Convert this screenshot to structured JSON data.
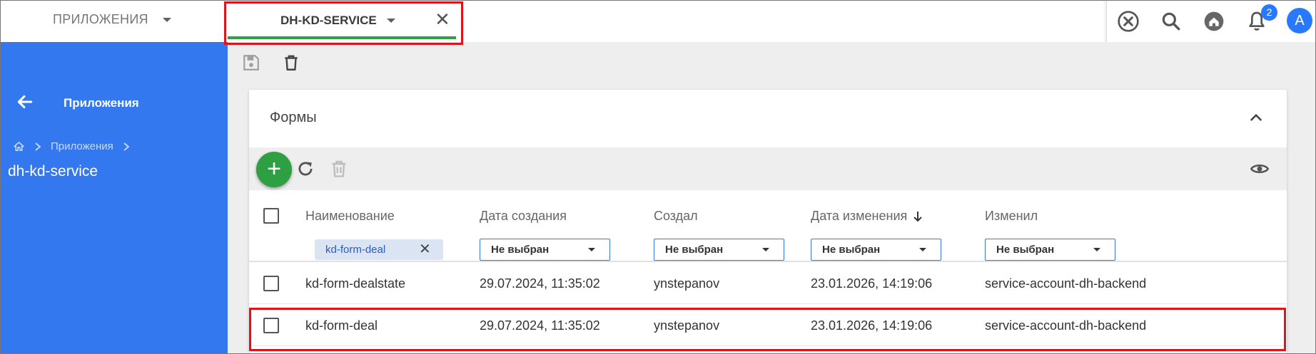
{
  "topbar": {
    "apps_label": "ПРИЛОЖЕНИЯ",
    "active_tab": "DH-KD-SERVICE",
    "notifications_count": "2",
    "avatar_letter": "A",
    "icons": [
      "cancel-circle-icon",
      "search-icon",
      "home-icon",
      "bell-icon"
    ]
  },
  "sidebar": {
    "title": "Приложения",
    "breadcrumb": "Приложения",
    "current": "dh-kd-service"
  },
  "panel": {
    "title": "Формы"
  },
  "table": {
    "headers": {
      "name": "Наименование",
      "created": "Дата создания",
      "author": "Создал",
      "modified": "Дата изменения",
      "modifier": "Изменил"
    },
    "filters": {
      "name_chip": "kd-form-deal",
      "created": "Не выбран",
      "author": "Не выбран",
      "modified": "Не выбран",
      "modifier": "Не выбран"
    },
    "rows": [
      {
        "name": "kd-form-dealstate",
        "created": "29.07.2024, 11:35:02",
        "author": "ynstepanov",
        "modified": "23.01.2026, 14:19:06",
        "modifier": "service-account-dh-backend"
      },
      {
        "name": "kd-form-deal",
        "created": "29.07.2024, 11:35:02",
        "author": "ynstepanov",
        "modified": "23.01.2026, 14:19:06",
        "modifier": "service-account-dh-backend"
      }
    ]
  },
  "colors": {
    "accent": "#3478f0",
    "success": "#2ea043",
    "highlight": "#e0131a"
  }
}
